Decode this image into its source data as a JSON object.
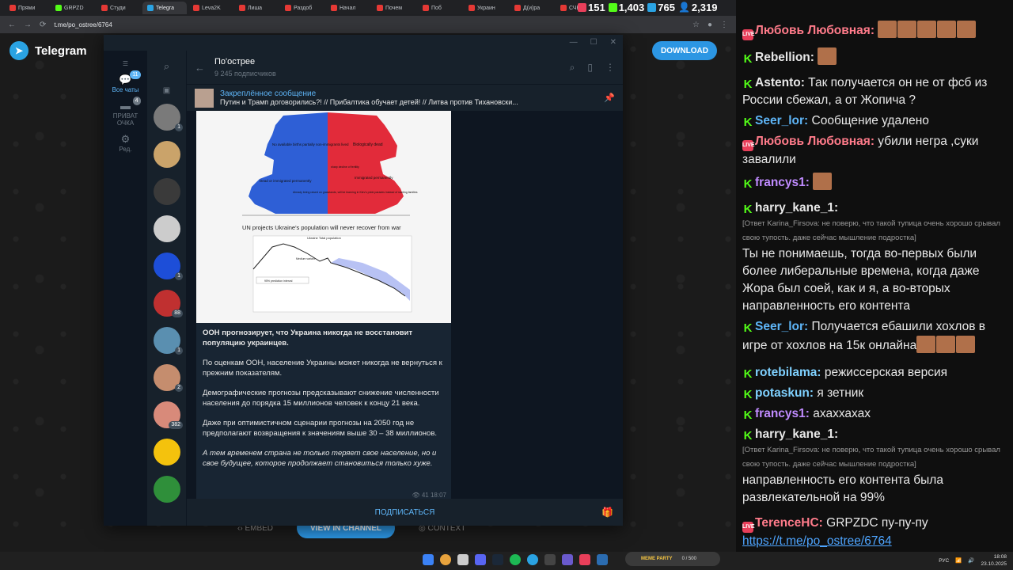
{
  "browser": {
    "tabs": [
      "Прями",
      "GRPZD",
      "Студи",
      "Telegra",
      "Leva2K",
      "Лиша",
      "Раздоб",
      "Начал",
      "Почем",
      "Поб",
      "Украин",
      "Д(и)ра",
      "СЧЕ"
    ],
    "url": "t.me/po_ostree/6764"
  },
  "page": {
    "brand": "Telegram",
    "download": "DOWNLOAD",
    "embed": "EMBED",
    "view_in_channel": "VIEW IN CHANNEL",
    "context": "CONTEXT"
  },
  "telegram": {
    "folders": [
      {
        "label": "Все чаты",
        "badge": "11"
      },
      {
        "label": "ПРИВАТ ОЧКА",
        "badge": "4"
      },
      {
        "label": "Ред.",
        "badge": ""
      }
    ],
    "chat_badges": [
      "1",
      "",
      "",
      "",
      "1",
      "88",
      "1",
      "2",
      "382",
      "",
      ""
    ],
    "channel_title": "По'острее",
    "channel_subs": "9 245 подписчиков",
    "pinned_title": "Закреплённое сообщение",
    "pinned_text": "Путин и Трамп договорились?! // Прибалтика обучает детей! // Литва против Тихановски...",
    "msg_headline": "ООН прогнозирует, что Украина никогда не восстановит популяцию украинцев.",
    "msg_p1": "По оценкам ООН, население Украины может никогда не вернуться к прежним показателям.",
    "msg_p2": " Демографические прогнозы предсказывают снижение численности населения до порядка 15 миллионов человек к концу 21 века.",
    "msg_p3": "Даже при оптимистичном сценарии прогнозы на 2050 год не предполагают возвращения к значениям выше 30 – 38 миллионов.",
    "msg_p4": "А тем временем страна не только теряет свое население, но и свое будущее, которое продолжает становиться только хуже.",
    "msg_views": "41",
    "msg_time": "18:07",
    "subscribe": "ПОДПИСАТЬСЯ",
    "chart_caption": "UN projects Ukraine's population will never recover from war",
    "chart_title": "Ukraine  Total population",
    "legend_label": "95% prediction interval",
    "medium_label": "Medium variant",
    "pyramid_labels": {
      "top_left": "No available births partially non-immigrants lived",
      "top_right": "Biologically dead",
      "mid_right_small": "sharp decline of fertility",
      "mid_left": "Dead or immigrated permanently",
      "mid_right": "Immigrated permanently",
      "bottom": "Already being raised on grasslands, will be learning in Kiev's pride parades instead of starting families"
    }
  },
  "stream_stats": {
    "a": "151",
    "b": "1,403",
    "c": "765",
    "d": "2,319"
  },
  "chat": [
    {
      "platform": "live",
      "user": "Любовь Любовная:",
      "color": "#ff7b8a",
      "text": "",
      "emotes": 5
    },
    {
      "platform": "kick",
      "user": "Rebellion:",
      "color": "#e8e8e8",
      "text": "",
      "emotes": 1
    },
    {
      "platform": "kick",
      "user": "Astento:",
      "color": "#e8e8e8",
      "text": "Так получается он не от фсб из России сбежал, а от Жопича ?"
    },
    {
      "platform": "kick",
      "user": "Seer_lor:",
      "color": "#5eb5f7",
      "text": "Сообщение удалено"
    },
    {
      "platform": "live",
      "user": "Любовь Любовная:",
      "color": "#ff7b8a",
      "text": "убили негра ,суки завалили"
    },
    {
      "platform": "kick",
      "user": "francys1:",
      "color": "#c08bff",
      "text": "",
      "emotes": 1
    },
    {
      "platform": "kick",
      "user": "harry_kane_1:",
      "color": "#e8e8e8",
      "reply": "[Ответ Karina_Firsova: не поверю, что такой тупица очень хорошо срывал свою тупость. даже сейчас мышление подростка]",
      "text": "Ты не понимаешь, тогда во-первых были более либеральные времена, когда даже Жора был соей, как и я, а во-вторых направленность его контента"
    },
    {
      "platform": "kick",
      "user": "Seer_lor:",
      "color": "#5eb5f7",
      "text": "Получается ебашили хохлов в игре от хохлов на 15к онлайна",
      "emotes": 3
    },
    {
      "platform": "kick",
      "user": "rotebilama:",
      "color": "#7fd1ff",
      "text": "режиссерская версия"
    },
    {
      "platform": "kick",
      "user": "potaskun:",
      "color": "#7fd1ff",
      "text": "я зетник"
    },
    {
      "platform": "kick",
      "user": "francys1:",
      "color": "#c08bff",
      "text": "ахаххахах"
    },
    {
      "platform": "kick",
      "user": "harry_kane_1:",
      "color": "#e8e8e8",
      "reply": "[Ответ Karina_Firsova: не поверю, что такой тупица очень хорошо срывал свою тупость. даже сейчас мышление подростка]",
      "text": "направленность его контента была развлекательной на 99%"
    },
    {
      "platform": "live",
      "user": "TerenceHC:",
      "color": "#ff7b8a",
      "text": "GRPZDC пу-пу-пу",
      "link": "https://t.me/po_ostree/6764"
    }
  ],
  "taskbar": {
    "meme": "MEME PARTY",
    "meme_count": "0 / 500",
    "lang": "РУС",
    "time": "18:08",
    "date": "23.10.2025"
  }
}
